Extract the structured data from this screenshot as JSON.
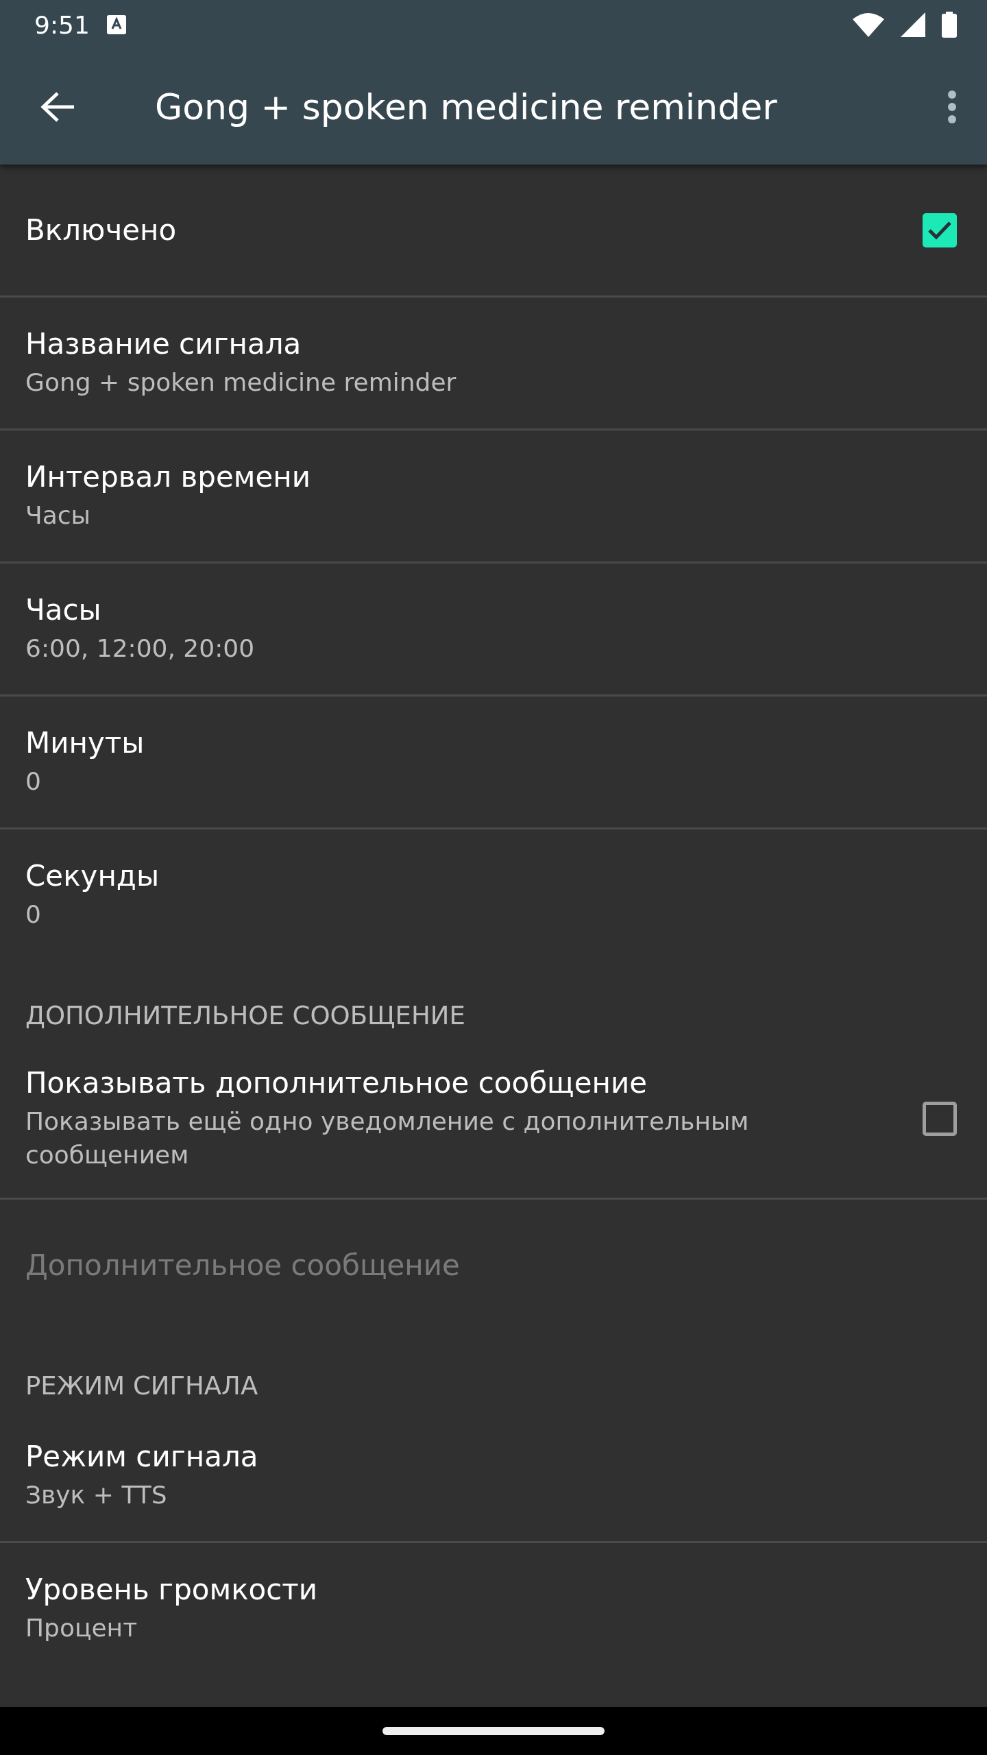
{
  "status_bar": {
    "time": "9:51"
  },
  "toolbar": {
    "title": "Gong + spoken medicine reminder"
  },
  "items": [
    {
      "kind": "checkbox",
      "title": "Включено",
      "checked": true,
      "disabled": false,
      "divider": true
    },
    {
      "kind": "text",
      "title": "Название сигнала",
      "summary": "Gong + spoken medicine reminder",
      "disabled": false,
      "divider": true
    },
    {
      "kind": "text",
      "title": "Интервал времени",
      "summary": "Часы",
      "disabled": false,
      "divider": true
    },
    {
      "kind": "text",
      "title": "Часы",
      "summary": "6:00, 12:00, 20:00",
      "disabled": false,
      "divider": true
    },
    {
      "kind": "text",
      "title": "Минуты",
      "summary": "0",
      "disabled": false,
      "divider": true
    },
    {
      "kind": "text",
      "title": "Секунды",
      "summary": "0",
      "disabled": false,
      "divider": false
    },
    {
      "kind": "category",
      "title": "ДОПОЛНИТЕЛЬНОЕ СООБЩЕНИЕ"
    },
    {
      "kind": "checkbox",
      "title": "Показывать дополнительное сообщение",
      "summary": "Показывать ещё одно уведомление с дополнительным сообщением",
      "checked": false,
      "disabled": false,
      "divider": true
    },
    {
      "kind": "text",
      "title": "Дополнительное сообщение",
      "disabled": true,
      "divider": false
    },
    {
      "kind": "category",
      "title": "РЕЖИМ СИГНАЛА"
    },
    {
      "kind": "text",
      "title": "Режим сигнала",
      "summary": "Звук + TTS",
      "disabled": false,
      "divider": true
    },
    {
      "kind": "text",
      "title": "Уровень громкости",
      "summary": "Процент",
      "disabled": false,
      "divider": false
    }
  ]
}
